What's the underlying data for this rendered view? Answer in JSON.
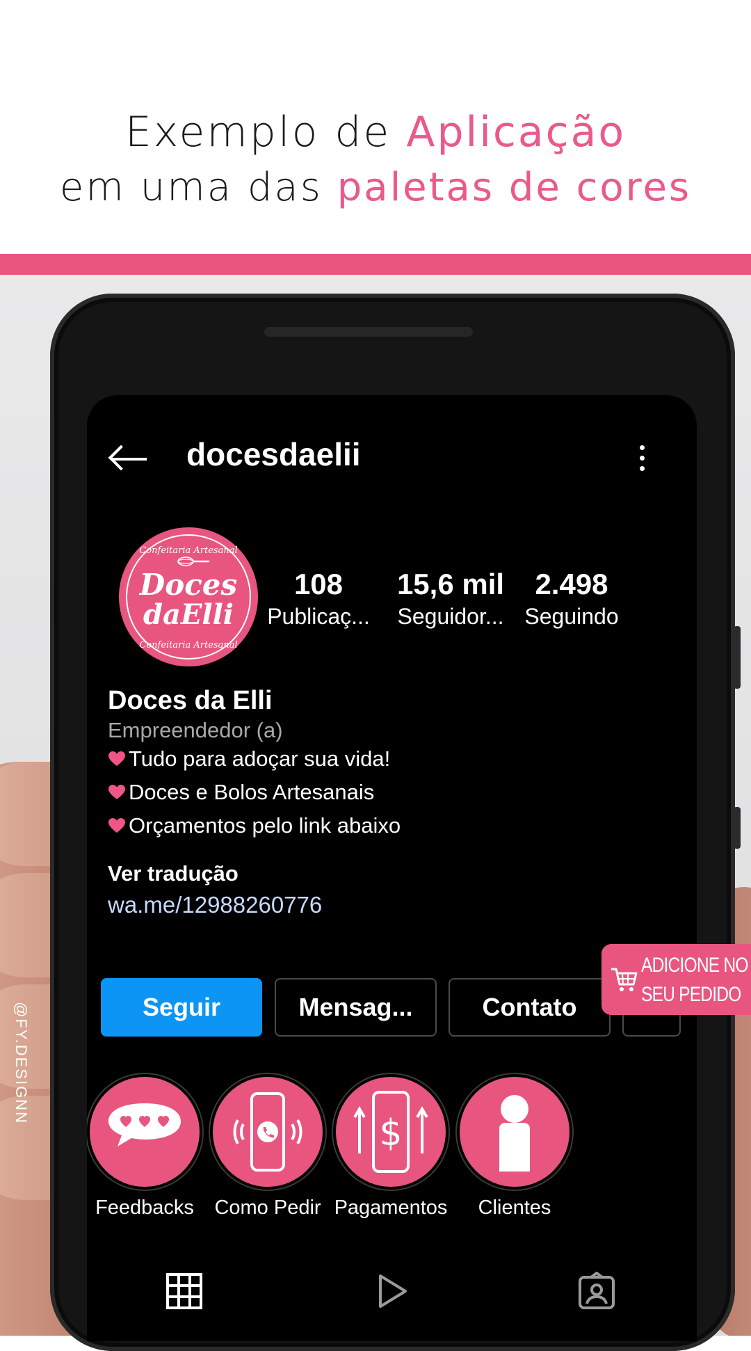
{
  "headline": {
    "line1_prefix": "Exemplo de ",
    "line1_accent": "Aplicação",
    "line2_prefix": "em uma das ",
    "line2_accent": "paletas de cores"
  },
  "colors": {
    "accent_pink": "#e8567f",
    "follow_blue": "#0d95f6",
    "screen_bg": "#000000"
  },
  "profile": {
    "username": "docesdaelii",
    "avatar": {
      "arc_top": "Confeitaria Artesanal",
      "logo_line1": "Doces",
      "logo_line2": "daElli",
      "arc_bottom": "Confeitaria Artesanal"
    },
    "stats": [
      {
        "value": "108",
        "label": "Publicaç..."
      },
      {
        "value": "15,6 mil",
        "label": "Seguidor..."
      },
      {
        "value": "2.498",
        "label": "Seguindo"
      }
    ],
    "name": "Doces da Elli",
    "category": "Empreendedor (a)",
    "bio": [
      "Tudo para adoçar sua vida!",
      "Doces e Bolos Artesanais",
      "Orçamentos pelo link abaixo"
    ],
    "translate": "Ver tradução",
    "link": "wa.me/12988260776"
  },
  "buttons": {
    "follow": "Seguir",
    "message": "Mensag...",
    "contact": "Contato"
  },
  "highlights": [
    {
      "label": "Feedbacks",
      "icon": "speech-bubble-hearts-icon"
    },
    {
      "label": "Como Pedir",
      "icon": "phone-whatsapp-icon"
    },
    {
      "label": "Pagamentos",
      "icon": "phone-dollar-icon"
    },
    {
      "label": "Clientes",
      "icon": "person-icon"
    }
  ],
  "bottom_nav": [
    "grid-icon",
    "reels-play-icon",
    "tagged-person-icon"
  ],
  "badge": {
    "line1": "ADICIONE NO",
    "line2": "SEU PEDIDO",
    "icon": "shopping-cart-icon"
  },
  "watermark": "@FY.DESIGNN"
}
